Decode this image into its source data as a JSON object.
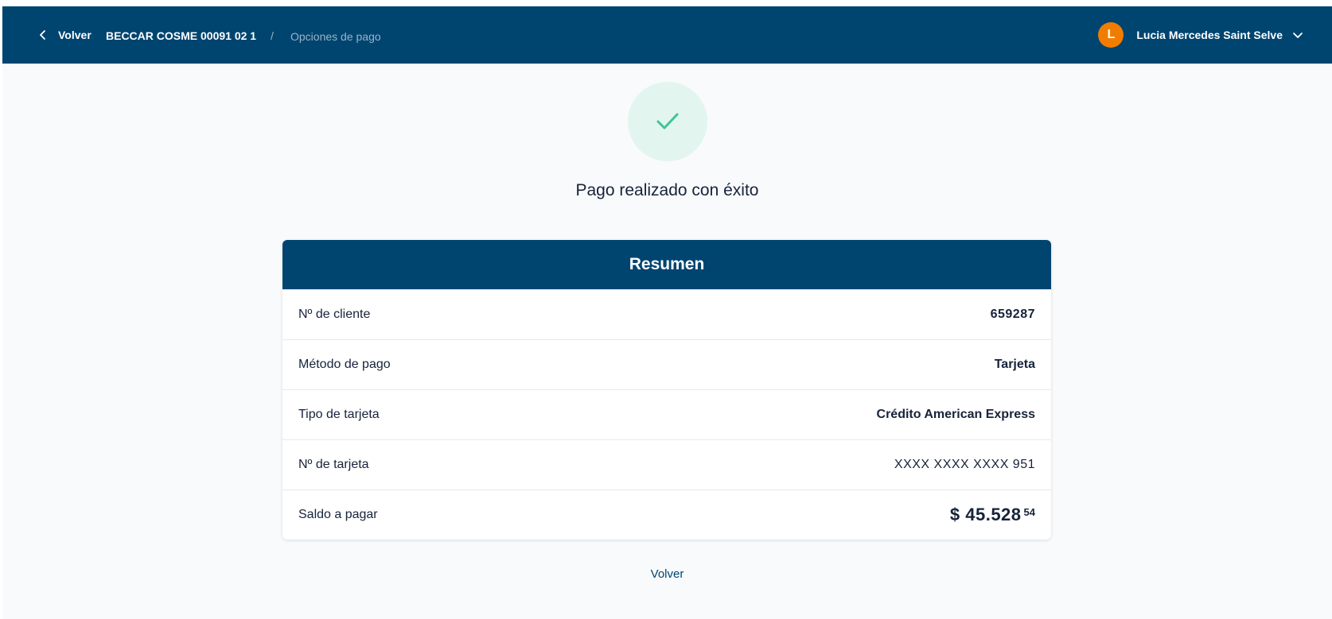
{
  "header": {
    "back_label": "Volver",
    "account_label": "BECCAR COSME 00091 02 1",
    "separator": "/",
    "current_page": "Opciones de pago",
    "user": {
      "initial": "L",
      "name": "Lucia Mercedes Saint Selve"
    }
  },
  "status": {
    "icon": "check-icon",
    "title": "Pago realizado con éxito"
  },
  "summary": {
    "title": "Resumen",
    "rows": [
      {
        "label": "Nº de cliente",
        "value": "659287"
      },
      {
        "label": "Método de pago",
        "value": "Tarjeta"
      },
      {
        "label": "Tipo de tarjeta",
        "value": "Crédito American Express"
      },
      {
        "label": "Nº de tarjeta",
        "value": "XXXX XXXX XXXX 951"
      },
      {
        "label": "Saldo a pagar",
        "value_main": "$ 45.528",
        "value_cents": "54"
      }
    ]
  },
  "footer": {
    "back_label": "Volver"
  },
  "colors": {
    "primary": "#004470",
    "accent_orange": "#f07d00",
    "success_green": "#3fc39a",
    "success_bg": "#e3f5ef"
  }
}
